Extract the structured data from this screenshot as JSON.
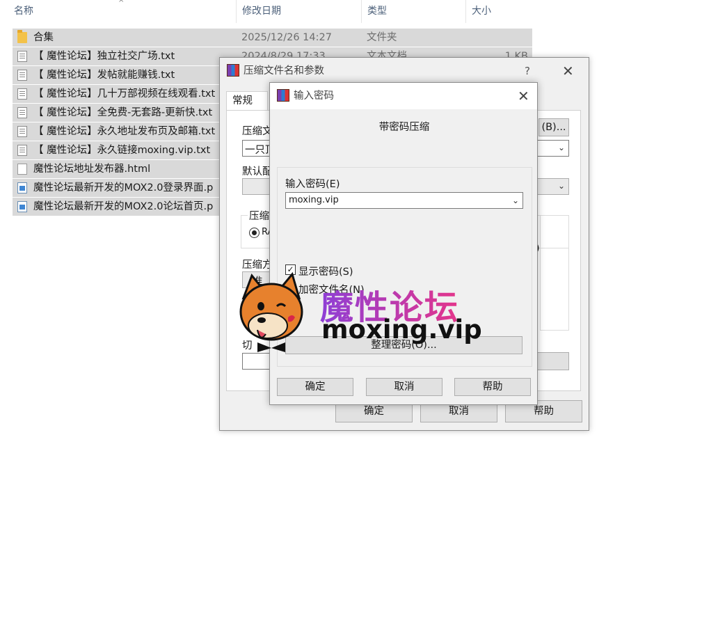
{
  "explorer": {
    "columns": {
      "name": "名称",
      "modified": "修改日期",
      "type": "类型",
      "size": "大小"
    },
    "sort_arrow": "^",
    "rows": [
      {
        "name": "合集",
        "date": "2025/12/26 14:27",
        "type": "文件夹",
        "size": "",
        "icon": "folder-icon"
      },
      {
        "name": "【 魔性论坛】独立社交广场.txt",
        "date": "2024/8/29 17:33",
        "type": "文本文档",
        "size": "1 KB",
        "icon": "text-file-icon"
      },
      {
        "name": "【 魔性论坛】发帖就能赚钱.txt",
        "date": "",
        "type": "",
        "size": "",
        "icon": "text-file-icon"
      },
      {
        "name": "【 魔性论坛】几十万部视频在线观看.txt",
        "date": "",
        "type": "",
        "size": "",
        "icon": "text-file-icon"
      },
      {
        "name": "【 魔性论坛】全免费-无套路-更新快.txt",
        "date": "",
        "type": "",
        "size": "",
        "icon": "text-file-icon"
      },
      {
        "name": "【 魔性论坛】永久地址发布页及邮箱.txt",
        "date": "",
        "type": "",
        "size": "",
        "icon": "text-file-icon"
      },
      {
        "name": "【 魔性论坛】永久链接moxing.vip.txt",
        "date": "",
        "type": "",
        "size": "",
        "icon": "text-file-icon"
      },
      {
        "name": "魔性论坛地址发布器.html",
        "date": "",
        "type": "",
        "size": "",
        "icon": "html-file-icon"
      },
      {
        "name": "魔性论坛最新开发的MOX2.0登录界面.p",
        "date": "",
        "type": "",
        "size": "",
        "icon": "image-file-icon"
      },
      {
        "name": "魔性论坛最新开发的MOX2.0论坛首页.p",
        "date": "",
        "type": "",
        "size": "",
        "icon": "image-file-icon"
      }
    ]
  },
  "archive_dialog": {
    "title": "压缩文件名和参数",
    "help_glyph": "?",
    "close_glyph": "✕",
    "tab_general": "常规",
    "browse_label": "(B)...",
    "label_archive_name": "压缩文",
    "archive_name_value": "一只顶",
    "label_default": "默认配",
    "label_format": "压缩",
    "format_rar": "RA",
    "label_method": "压缩方",
    "method_value": "准",
    "label_split": "切",
    "paren_close": ")",
    "ok": "确定",
    "cancel": "取消",
    "help": "帮助"
  },
  "password_dialog": {
    "title": "输入密码",
    "close_glyph": "✕",
    "heading": "带密码压缩",
    "enter_password_label": "输入密码(E)",
    "password_value": "moxing.vip",
    "show_password_label": "显示密码(S)",
    "show_password_checked": true,
    "encrypt_names_label": "加密文件名(N)",
    "organize_label": "整理密码(O)...",
    "ok": "确定",
    "cancel": "取消",
    "help": "帮助"
  },
  "watermark": {
    "title": "魔性论坛",
    "url": "moxing.vip"
  }
}
